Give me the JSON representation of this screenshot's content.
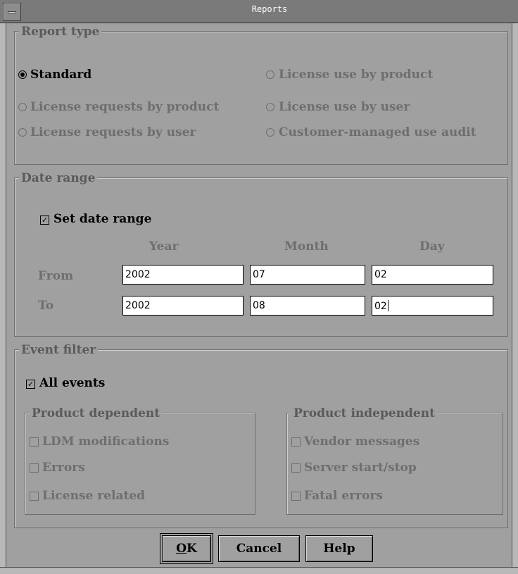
{
  "window": {
    "title": "Reports"
  },
  "report_type": {
    "title": "Report type",
    "options": [
      {
        "label": "Standard",
        "selected": true,
        "enabled": true
      },
      {
        "label": "License use by product",
        "selected": false,
        "enabled": false
      },
      {
        "label": "License requests by product",
        "selected": false,
        "enabled": false
      },
      {
        "label": "License use by user",
        "selected": false,
        "enabled": false
      },
      {
        "label": "License requests by user",
        "selected": false,
        "enabled": false
      },
      {
        "label": "Customer-managed use audit",
        "selected": false,
        "enabled": false
      }
    ]
  },
  "date_range": {
    "title": "Date range",
    "set_label": "Set date range",
    "set_checked": true,
    "col_year": "Year",
    "col_month": "Month",
    "col_day": "Day",
    "from_label": "From",
    "to_label": "To",
    "from": {
      "year": "2002",
      "month": "07",
      "day": "02"
    },
    "to": {
      "year": "2002",
      "month": "08",
      "day": "02"
    }
  },
  "event_filter": {
    "title": "Event filter",
    "all_label": "All events",
    "all_checked": true,
    "dependent": {
      "title": "Product dependent",
      "items": [
        {
          "label": "LDM modifications",
          "checked": false
        },
        {
          "label": "Errors",
          "checked": false
        },
        {
          "label": "License related",
          "checked": false
        }
      ]
    },
    "independent": {
      "title": "Product independent",
      "items": [
        {
          "label": "Vendor messages",
          "checked": false
        },
        {
          "label": "Server start/stop",
          "checked": false
        },
        {
          "label": "Fatal errors",
          "checked": false
        }
      ]
    }
  },
  "buttons": {
    "ok_mnemonic": "O",
    "ok_rest": "K",
    "cancel": "Cancel",
    "help": "Help"
  }
}
